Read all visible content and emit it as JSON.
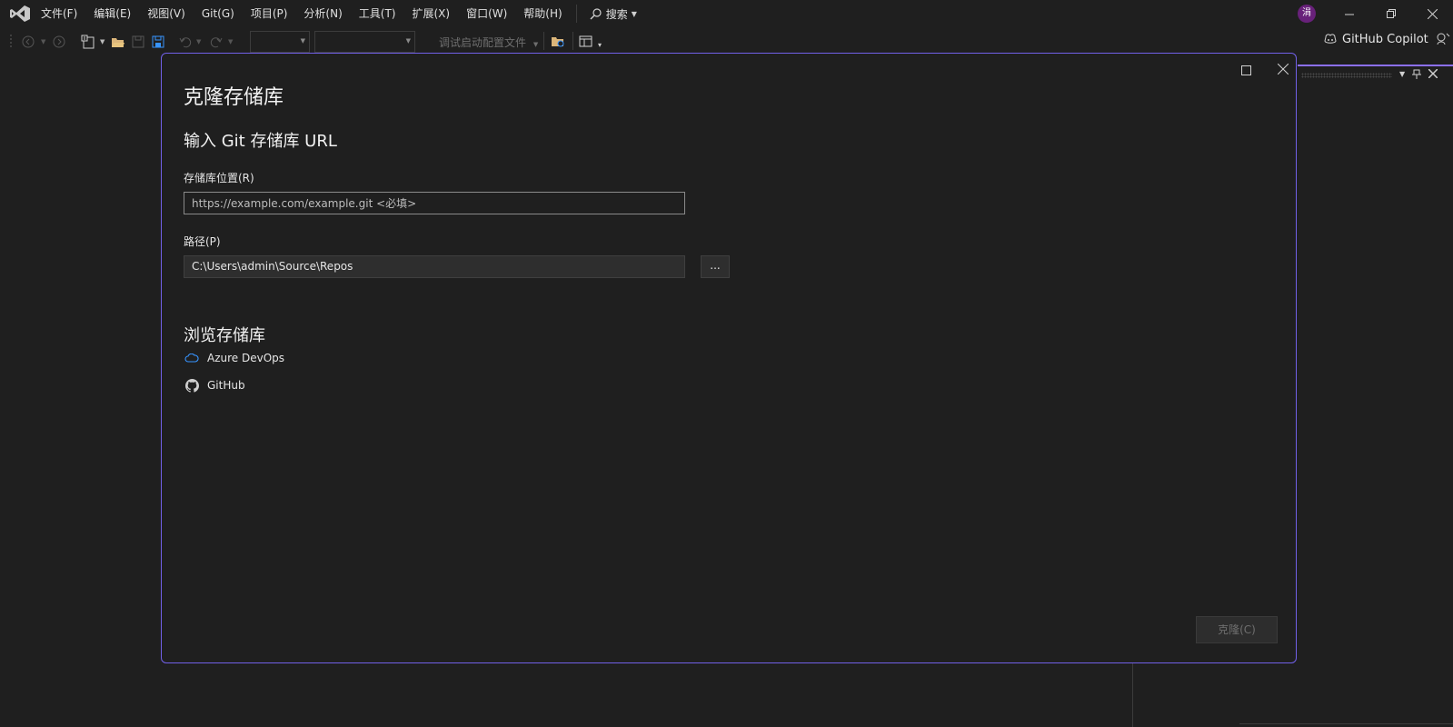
{
  "menubar": {
    "items": [
      "文件(F)",
      "编辑(E)",
      "视图(V)",
      "Git(G)",
      "项目(P)",
      "分析(N)",
      "工具(T)",
      "扩展(X)",
      "窗口(W)",
      "帮助(H)"
    ],
    "search_label": "搜索",
    "avatar_text": "涓"
  },
  "toolbar": {
    "debug_config": "调试启动配置文件",
    "copilot_label": "GitHub Copilot"
  },
  "dialog": {
    "title": "克隆存储库",
    "subtitle": "输入 Git 存储库 URL",
    "repo_location_label": "存储库位置(R)",
    "repo_url_placeholder": "https://example.com/example.git <必填>",
    "path_label": "路径(P)",
    "path_value": "C:\\Users\\admin\\Source\\Repos",
    "browse_label": "...",
    "browse_title": "浏览存储库",
    "services": [
      {
        "label": "Azure DevOps",
        "icon": "cloud-icon"
      },
      {
        "label": "GitHub",
        "icon": "github-icon"
      }
    ],
    "clone_label": "克隆(C)"
  },
  "colors": {
    "accent": "#7160e8",
    "background": "#1f1f1f",
    "avatar": "#68217a"
  }
}
